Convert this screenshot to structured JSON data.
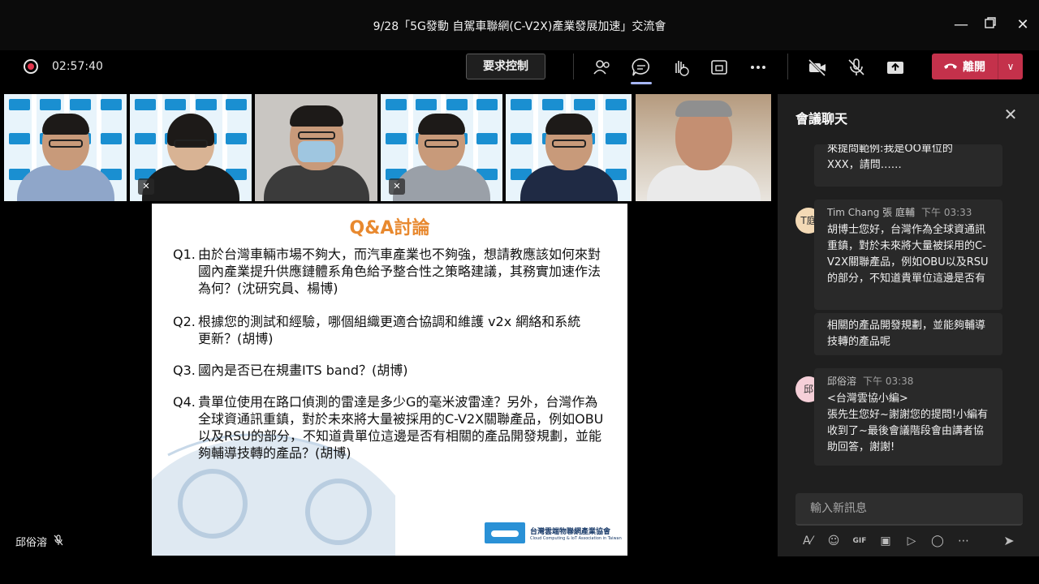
{
  "window": {
    "title": "9/28「5G發動 自駕車聯網(C-V2X)產業發展加速」交流會",
    "minimize_icon": "minimize-icon",
    "restore_icon": "restore-icon",
    "close_icon": "close-icon"
  },
  "toolbar": {
    "recording_time": "02:57:40",
    "request_control_label": "要求控制",
    "leave_label": "離開",
    "icons": [
      "participants-icon",
      "chat-icon",
      "raise-hand-icon",
      "share-screen-icon",
      "more-icon",
      "camera-off-icon",
      "mic-off-icon",
      "share-tray-icon"
    ],
    "colors": {
      "leave": "#c4314b",
      "active": "#a6b6f5",
      "record": "#e2364d"
    }
  },
  "participants": [
    {
      "muted": false,
      "background": "ciat"
    },
    {
      "muted": true,
      "background": "ciat"
    },
    {
      "muted": false,
      "background": "office",
      "selected": true
    },
    {
      "muted": true,
      "background": "ciat"
    },
    {
      "muted": false,
      "background": "ciat"
    },
    {
      "muted": false,
      "background": "office"
    }
  ],
  "slide": {
    "title": "Q&A討論",
    "questions": [
      {
        "num": "Q1.",
        "text": "由於台灣車輛市場不夠大，而汽車產業也不夠強，想請教應該如何來對國內產業提升供應鏈體系角色給予整合性之策略建議，其務實加速作法為何？(沈研究員、楊博)"
      },
      {
        "num": "Q2.",
        "text": "根據您的測試和經驗，哪個組織更適合協調和維護 v2x 網絡和系統更新？(胡博)"
      },
      {
        "num": "Q3.",
        "text": "國內是否已在規畫ITS band？(胡博)"
      },
      {
        "num": "Q4.",
        "text": "貴單位使用在路口偵測的雷達是多少G的毫米波雷達？另外，台灣作為全球資通訊重鎮，對於未來將大量被採用的C-V2X關聯產品，例如OBU以及RSU的部分，不知道貴單位這邊是否有相關的產品開發規劃，並能夠輔導技轉的產品？(胡博)"
      }
    ],
    "org_name": "台灣雲端物聯網產業協會",
    "org_sub": "Cloud Computing & IoT Association in Taiwan",
    "title_color": "#e8892f"
  },
  "presenter": {
    "name": "邱俗溶"
  },
  "chat": {
    "title": "會議聊天",
    "messages": [
      {
        "partial_text_1": "來提問範例:我是OO單位的",
        "partial_text_2": "XXX，請問……"
      },
      {
        "avatar_text": "T庭",
        "sender": "Tim Chang 張 庭輔",
        "time": "下午 03:33",
        "text": "胡博士您好，台灣作為全球資通訊重鎮，對於未來將大量被採用的C-V2X關聯產品，例如OBU以及RSU的部分，不知道貴單位這邊是否有",
        "followup": "相關的產品開發規劃，並能夠輔導技轉的產品呢"
      },
      {
        "avatar_text": "邱",
        "sender": "邱俗溶",
        "time": "下午 03:38",
        "line1": "<台灣雲協小編>",
        "text": "張先生您好~謝謝您的提問!小編有收到了~最後會議階段會由講者協助回答，謝謝!"
      }
    ],
    "compose_placeholder": "輸入新訊息",
    "compose_tools": [
      "format-icon",
      "emoji-icon",
      "gif-icon",
      "sticker-icon",
      "meet-now-icon",
      "praise-icon",
      "more-options-icon",
      "send-icon"
    ]
  }
}
